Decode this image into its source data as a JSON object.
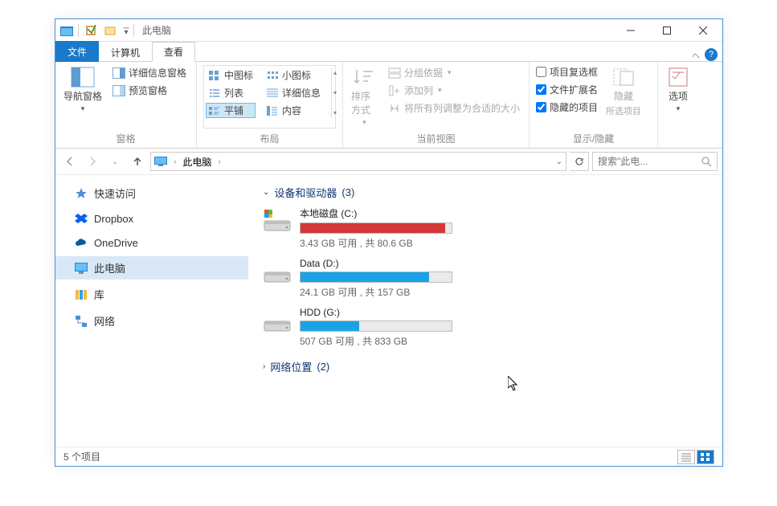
{
  "title": "此电脑",
  "tabs": {
    "file": "文件",
    "computer": "计算机",
    "view": "查看"
  },
  "ribbon": {
    "panes": {
      "nav_pane": "导航窗格",
      "preview_pane": "预览窗格",
      "details_pane": "详细信息窗格",
      "group_label": "窗格"
    },
    "layout": {
      "medium_icons": "中图标",
      "small_icons": "小图标",
      "list": "列表",
      "details": "详细信息",
      "tiles": "平铺",
      "content": "内容",
      "group_label": "布局"
    },
    "current_view": {
      "sort_by": "排序方式",
      "group_by": "分组依据",
      "add_column": "添加列",
      "autosize": "将所有列调整为合适的大小",
      "group_label": "当前视图"
    },
    "show_hide": {
      "checkboxes": "项目复选框",
      "extensions": "文件扩展名",
      "hidden_items": "隐藏的项目",
      "hide": "隐藏",
      "hide_sub": "所选项目",
      "group_label": "显示/隐藏"
    },
    "options": "选项"
  },
  "address": {
    "location": "此电脑"
  },
  "search_placeholder": "搜索\"此电...",
  "sidebar": {
    "quick_access": "快速访问",
    "dropbox": "Dropbox",
    "onedrive": "OneDrive",
    "this_pc": "此电脑",
    "libraries": "库",
    "network": "网络"
  },
  "content": {
    "section_drives": "设备和驱动器",
    "drive_count": "(3)",
    "section_network": "网络位置",
    "network_count": "(2)",
    "drives": [
      {
        "name": "本地磁盘 (C:)",
        "stat": "3.43 GB 可用 , 共 80.6 GB",
        "fill_pct": 96,
        "color": "red",
        "system": true
      },
      {
        "name": "Data (D:)",
        "stat": "24.1 GB 可用 , 共 157 GB",
        "fill_pct": 85,
        "color": "blue",
        "system": false
      },
      {
        "name": "HDD (G:)",
        "stat": "507 GB 可用 , 共 833 GB",
        "fill_pct": 39,
        "color": "blue",
        "system": false
      }
    ]
  },
  "statusbar": {
    "items": "5 个项目"
  }
}
